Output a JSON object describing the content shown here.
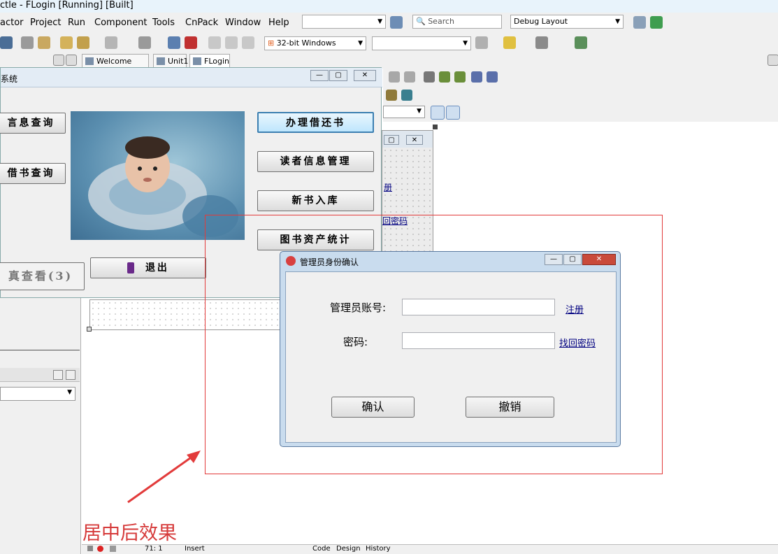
{
  "ide": {
    "title": "ctle - FLogin [Running] [Built]",
    "menu": [
      {
        "label": "actor"
      },
      {
        "label": "Project"
      },
      {
        "label": "Run"
      },
      {
        "label": "Component"
      },
      {
        "label": "Tools"
      },
      {
        "label": "CnPack"
      },
      {
        "label": "Window"
      },
      {
        "label": "Help"
      }
    ],
    "search_placeholder": "Search",
    "layout_combo": "Debug Layout",
    "platform_combo": "32-bit Windows",
    "tabs": [
      "Welcome Page",
      "Unit1",
      "FLogin"
    ],
    "status": {
      "position": "71:   1",
      "mode": "Insert",
      "views": [
        "Code",
        "Design",
        "History"
      ]
    }
  },
  "designer": {
    "link_register": "册",
    "link_password": "回密码"
  },
  "main_window": {
    "title": "系统",
    "buttons_left": [
      "言息查询",
      "借书查询"
    ],
    "buttons_right": [
      "办理借还书",
      "读者信息管理",
      "新书入库",
      "图书资产统计"
    ],
    "button_view": "真查看(3)",
    "button_exit": "退出"
  },
  "dialog": {
    "title": "管理员身份确认",
    "account_label": "管理员账号:",
    "account_value": "",
    "password_label": "密码:",
    "password_value": "",
    "register_link": "注册",
    "recover_link": "找回密码",
    "confirm_button": "确认",
    "cancel_button": "撤销"
  },
  "annotation": {
    "caption": "居中后效果",
    "color": "#d63a3a"
  }
}
